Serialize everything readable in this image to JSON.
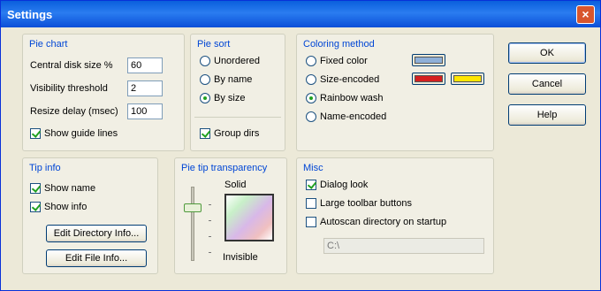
{
  "window": {
    "title": "Settings",
    "close_glyph": "×"
  },
  "pie_chart": {
    "label": "Pie chart",
    "central_disk_label": "Central disk size %",
    "central_disk_value": "60",
    "visibility_label": "Visibility threshold",
    "visibility_value": "2",
    "resize_delay_label": "Resize delay (msec)",
    "resize_delay_value": "100",
    "show_guide_lines_label": "Show guide lines",
    "show_guide_lines_checked": true
  },
  "pie_sort": {
    "label": "Pie sort",
    "options": [
      "Unordered",
      "By name",
      "By size"
    ],
    "selected": "By size",
    "group_dirs_label": "Group dirs",
    "group_dirs_checked": true
  },
  "coloring": {
    "label": "Coloring method",
    "options": [
      "Fixed color",
      "Size-encoded",
      "Rainbow wash",
      "Name-encoded"
    ],
    "selected": "Rainbow wash",
    "fixed_color": "#8fb0d8",
    "size_color_low": "#d42020",
    "size_color_high": "#ffe600"
  },
  "buttons": {
    "ok": "OK",
    "cancel": "Cancel",
    "help": "Help"
  },
  "tip_info": {
    "label": "Tip info",
    "show_name_label": "Show name",
    "show_name_checked": true,
    "show_info_label": "Show info",
    "show_info_checked": true,
    "edit_directory_label": "Edit Directory Info...",
    "edit_file_label": "Edit File Info..."
  },
  "transparency": {
    "label": "Pie tip transparency",
    "solid_label": "Solid",
    "invisible_label": "Invisible",
    "level": 0.75
  },
  "misc": {
    "label": "Misc",
    "dialog_look_label": "Dialog look",
    "dialog_look_checked": true,
    "large_toolbar_label": "Large toolbar buttons",
    "large_toolbar_checked": false,
    "autoscan_label": "Autoscan directory on startup",
    "autoscan_checked": false,
    "autoscan_path": "C:\\"
  }
}
